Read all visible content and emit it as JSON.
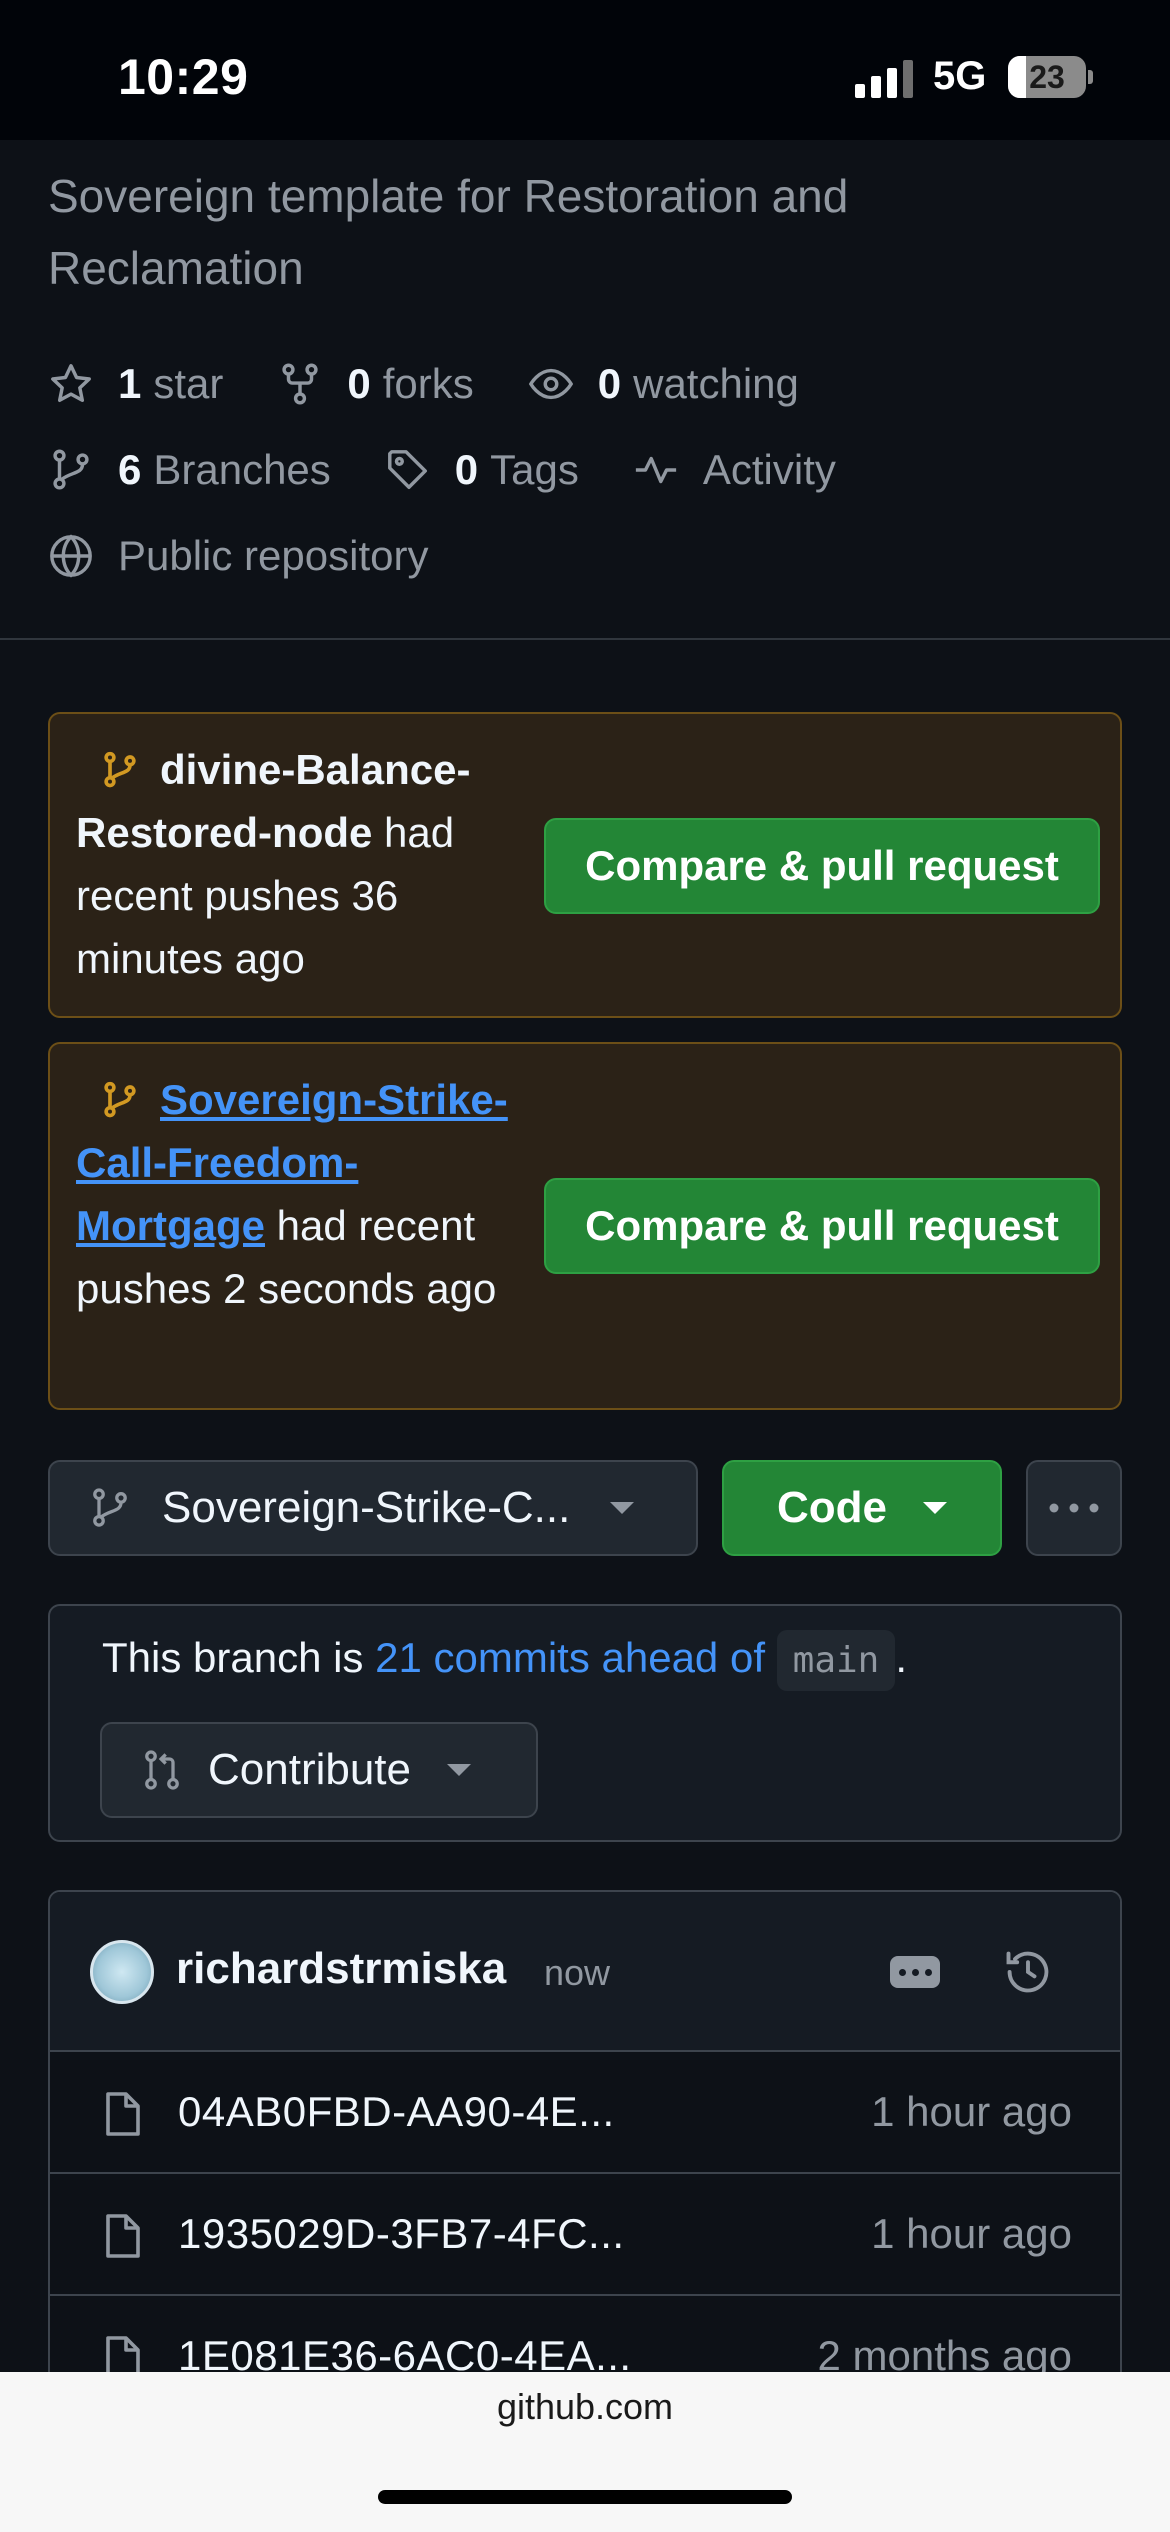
{
  "status_bar": {
    "time": "10:29",
    "network": "5G",
    "battery": "23"
  },
  "repo": {
    "description": "Sovereign template for Restoration and Reclamation",
    "stars": {
      "count": "1",
      "label": "star"
    },
    "forks": {
      "count": "0",
      "label": "forks"
    },
    "watching": {
      "count": "0",
      "label": "watching"
    },
    "branches": {
      "count": "6",
      "label": "Branches"
    },
    "tags": {
      "count": "0",
      "label": "Tags"
    },
    "activity_label": "Activity",
    "visibility": "Public repository"
  },
  "recent_pushes": [
    {
      "branch": "divine-Balance-Restored-node",
      "message": " had recent pushes 36 minutes ago",
      "button": "Compare & pull request"
    },
    {
      "branch": "Sovereign-Strike-Call-Freedom-Mortgage",
      "message": " had recent pushes 2 seconds ago",
      "button": "Compare & pull request"
    }
  ],
  "toolbar": {
    "branch_label": "Sovereign-Strike-C...",
    "code_label": "Code"
  },
  "ahead": {
    "prefix": "This branch is ",
    "link": "21 commits ahead of",
    "base": "main",
    "suffix": ".",
    "contribute_label": "Contribute"
  },
  "latest_commit": {
    "user": "richardstrmiska",
    "time": "now"
  },
  "files": [
    {
      "name": "04AB0FBD-AA90-4E...",
      "time": "1 hour ago"
    },
    {
      "name": "1935029D-3FB7-4FC...",
      "time": "1 hour ago"
    },
    {
      "name": "1E081E36-6AC0-4EA...",
      "time": "2 months ago"
    }
  ],
  "browser": {
    "url": "github.com"
  },
  "colors": {
    "background": "#0d1117",
    "green": "#238636",
    "link": "#4493f8",
    "branch_icon": "#d29922"
  }
}
